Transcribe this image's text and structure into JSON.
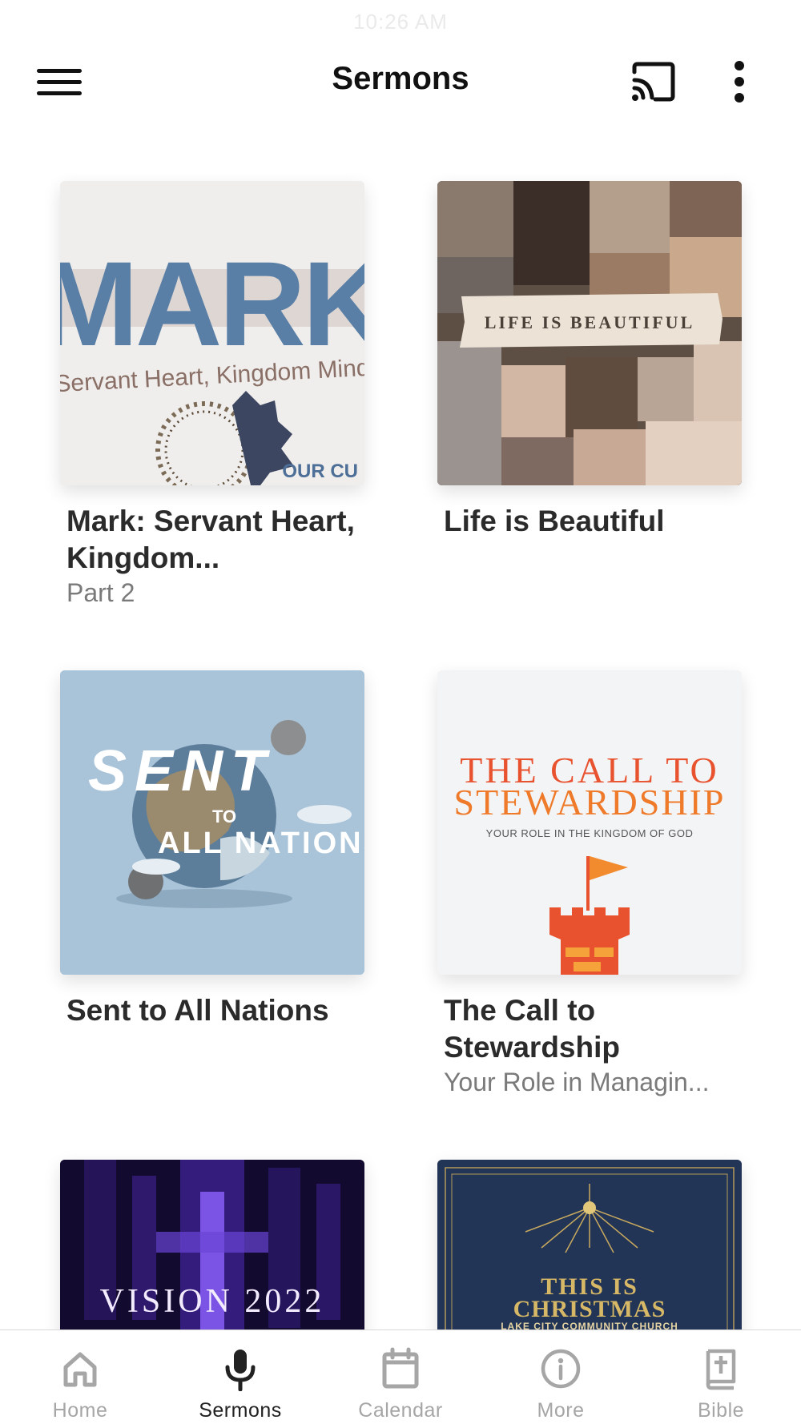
{
  "status_bar": {
    "time": "10:26 AM"
  },
  "header": {
    "title": "Sermons"
  },
  "sermons": [
    {
      "title": "Mark: Servant Heart, Kingdom...",
      "subtitle": "Part 2",
      "art": {
        "headline": "MARK",
        "tagline": "Servant Heart, Kingdom Mind",
        "corner": "OUR CU"
      }
    },
    {
      "title": "Life is Beautiful",
      "subtitle": "",
      "art": {
        "banner": "LIFE IS BEAUTIFUL"
      }
    },
    {
      "title": "Sent to All Nations",
      "subtitle": "",
      "art": {
        "line1": "SENT",
        "line2": "TO",
        "line3": "ALL NATIONS"
      }
    },
    {
      "title": "The Call to Stewardship",
      "subtitle": "Your Role in Managin...",
      "art": {
        "line1": "THE CALL TO",
        "line2": "STEWARDSHIP",
        "tagline": "YOUR ROLE IN THE KINGDOM OF GOD"
      }
    },
    {
      "title": "",
      "subtitle": "",
      "art": {
        "headline": "VISION 2022"
      }
    },
    {
      "title": "",
      "subtitle": "",
      "art": {
        "line1": "THIS IS",
        "line2": "CHRISTMAS",
        "tagline": "LAKE CITY COMMUNITY CHURCH"
      }
    }
  ],
  "bottom_nav": [
    {
      "label": "Home",
      "icon": "home-icon",
      "active": false
    },
    {
      "label": "Sermons",
      "icon": "microphone-icon",
      "active": true
    },
    {
      "label": "Calendar",
      "icon": "calendar-icon",
      "active": false
    },
    {
      "label": "More",
      "icon": "info-icon",
      "active": false
    },
    {
      "label": "Bible",
      "icon": "bible-icon",
      "active": false
    }
  ],
  "colors": {
    "accent_active": "#222222",
    "inactive": "#a6a6a6",
    "mark_blue": "#5a7fa6",
    "stewardship_orange": "#e8522e",
    "sent_sky": "#a9c3d9"
  }
}
